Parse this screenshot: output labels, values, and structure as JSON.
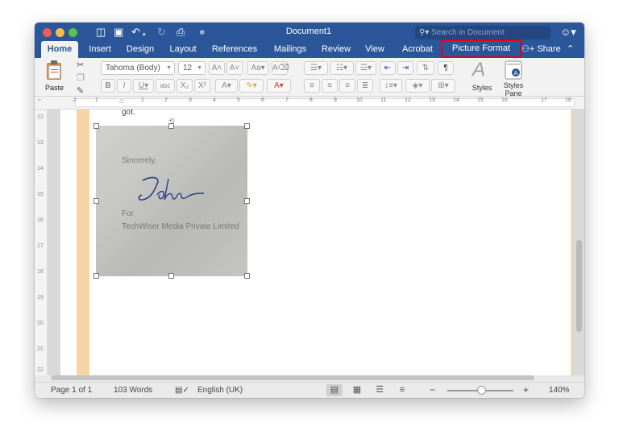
{
  "window": {
    "title": "Document1"
  },
  "search": {
    "placeholder": "Search in Document"
  },
  "tabs": [
    {
      "label": "Home"
    },
    {
      "label": "Insert"
    },
    {
      "label": "Design"
    },
    {
      "label": "Layout"
    },
    {
      "label": "References"
    },
    {
      "label": "Mailings"
    },
    {
      "label": "Review"
    },
    {
      "label": "View"
    },
    {
      "label": "Acrobat"
    },
    {
      "label": "Picture Format"
    }
  ],
  "share_label": "Share",
  "ribbon": {
    "paste_label": "Paste",
    "font_name": "Tahoma (Body)",
    "font_size": "12",
    "styles_label": "Styles",
    "styles_pane_label": "Styles Pane",
    "styles_pane_line1": "Styles",
    "styles_pane_line2": "Pane"
  },
  "document": {
    "partial_text": "got.",
    "signature_image": {
      "sincerely": "Sincerely,",
      "signature": "John",
      "for_label": "For",
      "company": "TechWiser Media Private Limited"
    }
  },
  "status": {
    "page": "Page 1 of 1",
    "words": "103 Words",
    "language": "English (UK)",
    "zoom": "140%",
    "zoom_minus": "−",
    "zoom_plus": "+"
  },
  "colors": {
    "accent": "#2b579a",
    "highlight_border": "#e2001a",
    "gutter": "#f7d4a3"
  }
}
